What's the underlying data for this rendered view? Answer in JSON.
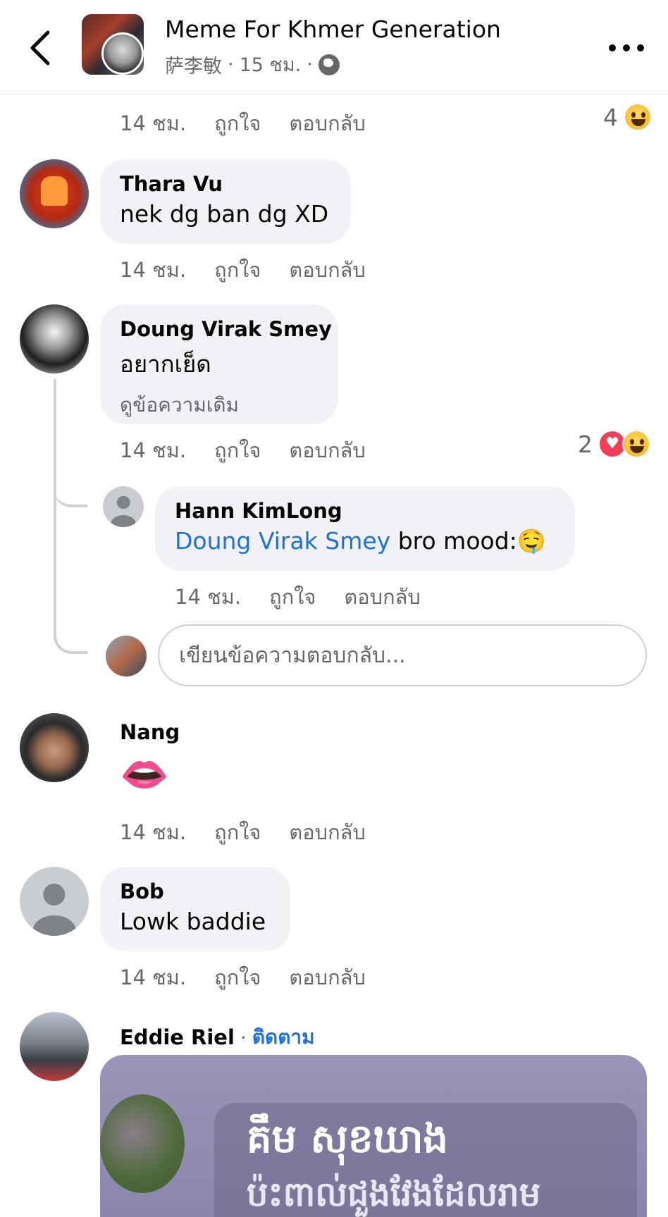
{
  "header": {
    "group_name": "Meme For Khmer Generation",
    "poster": "萨李敏",
    "time": "15 ชม.",
    "dot": "·"
  },
  "labels": {
    "like": "ถูกใจ",
    "reply": "ตอบกลับ"
  },
  "comments": [
    {
      "time": "14 ชม.",
      "reaction_count": "4",
      "reactions": [
        "haha"
      ]
    },
    {
      "name": "Thara Vu",
      "text": "nek dg ban dg XD",
      "time": "14 ชม."
    },
    {
      "name": "Doung Virak Smey",
      "text": "อยากเย็ด",
      "see_original": "ดูข้อความเดิม",
      "time": "14 ชม.",
      "reaction_count": "2",
      "reactions": [
        "love",
        "haha"
      ]
    },
    {
      "name": "Hann KimLong",
      "mention": "Doung Virak Smey",
      "text": "bro mood:🤤",
      "time": "14 ชม."
    },
    {
      "name": "Nang",
      "text": "👄",
      "time": "14 ชม."
    },
    {
      "name": "Bob",
      "text": "Lowk baddie",
      "time": "14 ชม."
    },
    {
      "name": "Eddie Riel",
      "follow": "ติดตาม",
      "image_text_line1": "គឹម សុខឃាង",
      "image_text_line2": "ប៉ះពាល់ជួងវែងដែលរាម"
    }
  ],
  "reply_input": {
    "placeholder": "เขียนข้อความตอบกลับ..."
  },
  "colors": {
    "bubble": "#f0f2f5",
    "meta_text": "#65676b",
    "link": "#216fdb",
    "love": "#f33e58",
    "haha": "#f7b125"
  },
  "icons": [
    "back-arrow-icon",
    "globe-icon",
    "more-options-icon",
    "default-avatar-icon",
    "haha-reaction-icon",
    "love-reaction-icon"
  ]
}
